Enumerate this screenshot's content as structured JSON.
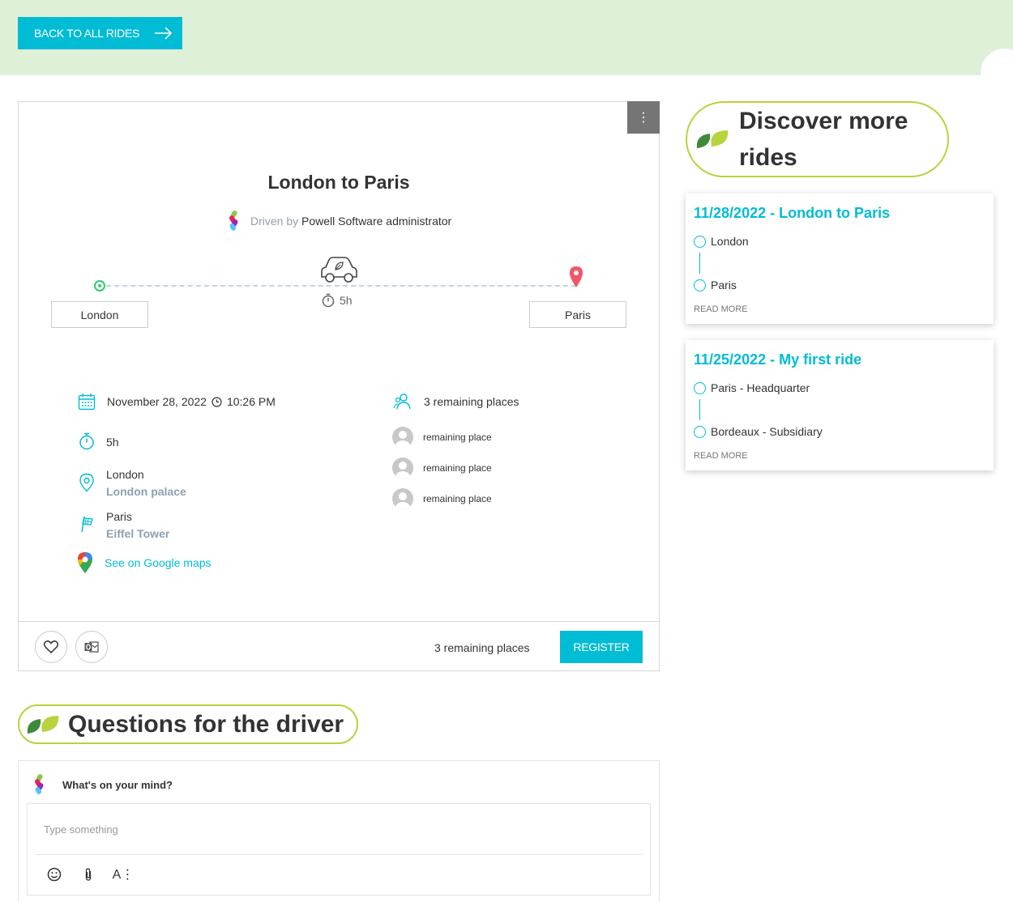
{
  "header": {
    "back_label": "BACK TO ALL RIDES"
  },
  "ride": {
    "title": "London to Paris",
    "driven_by_label": "Driven by",
    "driver_name": "Powell Software administrator",
    "route_duration": "5h",
    "start_city": "London",
    "end_city": "Paris",
    "date": "November 28, 2022",
    "time": "10:26 PM",
    "duration": "5h",
    "departure_city": "London",
    "departure_place": "London palace",
    "arrival_city": "Paris",
    "arrival_place": "Eiffel Tower",
    "maps_link": "See on Google maps",
    "remaining_summary": "3 remaining places",
    "places": [
      "remaining place",
      "remaining place",
      "remaining place"
    ]
  },
  "footer": {
    "remaining": "3 remaining places",
    "register_label": "REGISTER"
  },
  "discover": {
    "heading_line1": "Discover more",
    "heading_line2": "rides",
    "rides": [
      {
        "title": "11/28/2022 - London to Paris",
        "from": "London",
        "to": "Paris",
        "read_more": "READ MORE"
      },
      {
        "title": "11/25/2022 - My first ride",
        "from": "Paris - Headquarter",
        "to": "Bordeaux - Subsidiary",
        "read_more": "READ MORE"
      }
    ]
  },
  "questions": {
    "heading": "Questions for the driver",
    "prompt": "What's on your mind?",
    "placeholder": "Type something"
  },
  "colors": {
    "accent": "#00bcd4",
    "leaf_green": "#b7d33d",
    "banner": "#dff0d8"
  }
}
